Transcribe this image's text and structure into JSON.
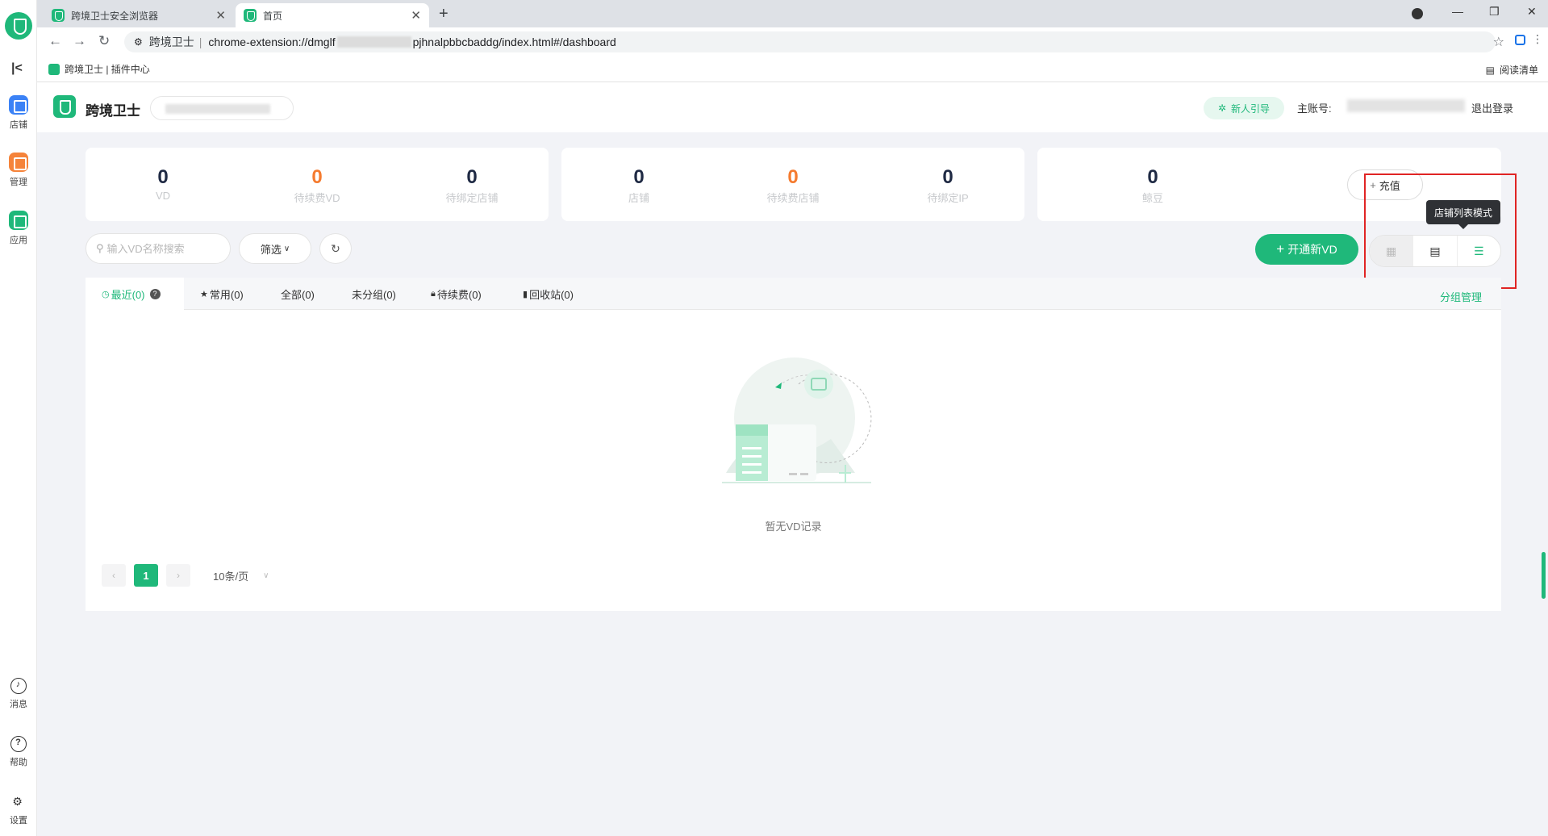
{
  "browser": {
    "tabs": [
      {
        "title": "跨境卫士安全浏览器",
        "active": false
      },
      {
        "title": "首页",
        "active": true
      }
    ],
    "url_ext_name": "跨境卫士",
    "url_prefix": "chrome-extension://dmglf",
    "url_suffix": "pjhnalpbbcbaddg/index.html#/dashboard",
    "bookmark": "跨境卫士 | 插件中心",
    "reading_list": "阅读清单"
  },
  "sidebar": {
    "items": [
      {
        "label": "店铺",
        "icon": "shop-icon",
        "color": "#3b82f6"
      },
      {
        "label": "管理",
        "icon": "manage-icon",
        "color": "#f5833a"
      },
      {
        "label": "应用",
        "icon": "apps-icon",
        "color": "#1fb87a"
      },
      {
        "label": "消息",
        "icon": "bell-icon"
      },
      {
        "label": "帮助",
        "icon": "help-icon",
        "glyph": "?"
      },
      {
        "label": "设置",
        "icon": "settings-icon",
        "glyph": "⚙"
      }
    ]
  },
  "header": {
    "brand": "跨境卫士",
    "guide": "新人引导",
    "account_label": "主账号:",
    "logout": "退出登录"
  },
  "stats": {
    "card1": [
      {
        "value": "0",
        "label": "VD",
        "highlight": false
      },
      {
        "value": "0",
        "label": "待续费VD",
        "highlight": true
      },
      {
        "value": "0",
        "label": "待绑定店铺",
        "highlight": false
      }
    ],
    "card2": [
      {
        "value": "0",
        "label": "店铺",
        "highlight": false
      },
      {
        "value": "0",
        "label": "待续费店铺",
        "highlight": true
      },
      {
        "value": "0",
        "label": "待绑定IP",
        "highlight": false
      }
    ],
    "card3": [
      {
        "value": "0",
        "label": "鲸豆",
        "highlight": false
      }
    ],
    "recharge": "充值"
  },
  "toolbar": {
    "search_placeholder": "输入VD名称搜索",
    "filter": "筛选",
    "open_vd": "开通新VD",
    "tooltip": "店铺列表模式"
  },
  "tabs": {
    "recent": "最近(0)",
    "common": "常用(0)",
    "all": "全部(0)",
    "ungrouped": "未分组(0)",
    "renew": "待续费(0)",
    "recycle": "回收站(0)",
    "group_manage": "分组管理"
  },
  "empty": {
    "text": "暂无VD记录"
  },
  "pager": {
    "current": "1",
    "page_size": "10条/页"
  },
  "colors": {
    "accent": "#1fb87a",
    "warning": "#f57b2f",
    "highlight_border": "#e02424"
  }
}
